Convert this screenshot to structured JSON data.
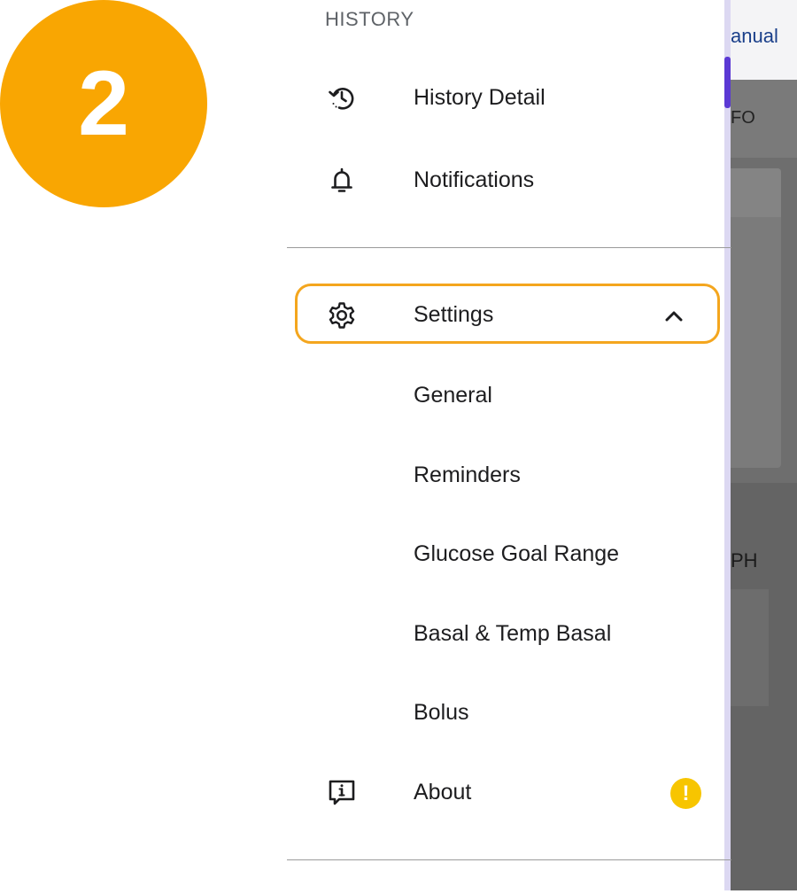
{
  "step_badge": {
    "number": "2",
    "color": "#f9a602"
  },
  "drawer": {
    "section_header": "HISTORY",
    "items": [
      {
        "label": "History Detail",
        "icon": "history-icon"
      },
      {
        "label": "Notifications",
        "icon": "bell-icon"
      },
      {
        "label": "Settings",
        "icon": "gear-icon",
        "expanded": true,
        "highlight_color": "#f4a61e"
      },
      {
        "label": "General"
      },
      {
        "label": "Reminders"
      },
      {
        "label": "Glucose Goal Range"
      },
      {
        "label": "Basal & Temp Basal"
      },
      {
        "label": "Bolus"
      },
      {
        "label": "About",
        "icon": "info-message-icon",
        "alert": "!"
      }
    ]
  },
  "background": {
    "manual_link": "anual",
    "tab_label": "FO",
    "section_label": "PH"
  },
  "colors": {
    "accent": "#5b39d4",
    "alert": "#f7c500",
    "dim_overlay": "#6e6e6e"
  }
}
